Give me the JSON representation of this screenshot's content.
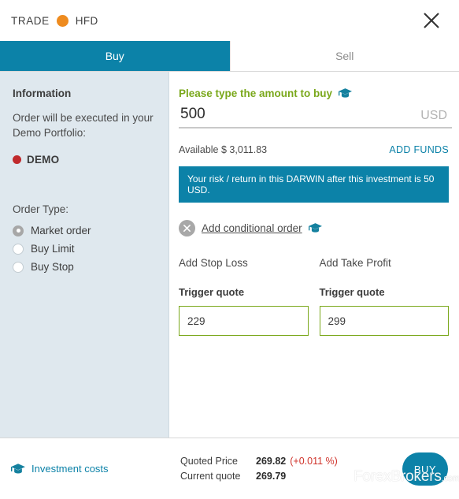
{
  "header": {
    "trade_label": "TRADE",
    "asset_name": "HFD",
    "asset_dot_color": "#ee8b1f",
    "close_icon": "close-icon"
  },
  "tabs": [
    {
      "label": "Buy",
      "active": true
    },
    {
      "label": "Sell",
      "active": false
    }
  ],
  "sidebar": {
    "title": "Information",
    "description": "Order will be executed in your Demo Portfolio:",
    "portfolio": {
      "label": "DEMO",
      "dot_color": "#c02a2c"
    },
    "order_type_label": "Order Type:",
    "order_types": [
      {
        "label": "Market order",
        "selected": true
      },
      {
        "label": "Buy Limit",
        "selected": false
      },
      {
        "label": "Buy Stop",
        "selected": false
      }
    ]
  },
  "main": {
    "amount_prompt": "Please type the amount to buy",
    "amount_value": "500",
    "amount_placeholder": "0",
    "currency": "USD",
    "available_text": "Available $ 3,011.83",
    "add_funds_label": "ADD FUNDS",
    "risk_banner": "Your risk / return in this DARWIN after this investment is 50 USD.",
    "conditional_order_label": "Add conditional order",
    "stop_loss": {
      "title": "Add Stop Loss",
      "field_label": "Trigger quote",
      "value": "229",
      "placeholder": "",
      "border_color": "#7aa81b"
    },
    "take_profit": {
      "title": "Add Take Profit",
      "field_label": "Trigger quote",
      "value": "299",
      "placeholder": "",
      "border_color": "#7aa81b"
    }
  },
  "footer": {
    "investment_costs_label": "Investment costs",
    "quoted_price_label": "Quoted Price",
    "quoted_price_value": "269.82",
    "quoted_price_delta": "(+0.011 %)",
    "current_quote_label": "Current quote",
    "current_quote_value": "269.79",
    "buy_button_label": "BUY"
  },
  "watermark": {
    "text": "ForexBrokers",
    "suffix": ".com"
  },
  "colors": {
    "accent_teal": "#0c82a8",
    "green": "#7aa81b",
    "sidebar_bg": "#dfe8ee",
    "delta_red": "#d0342c"
  }
}
